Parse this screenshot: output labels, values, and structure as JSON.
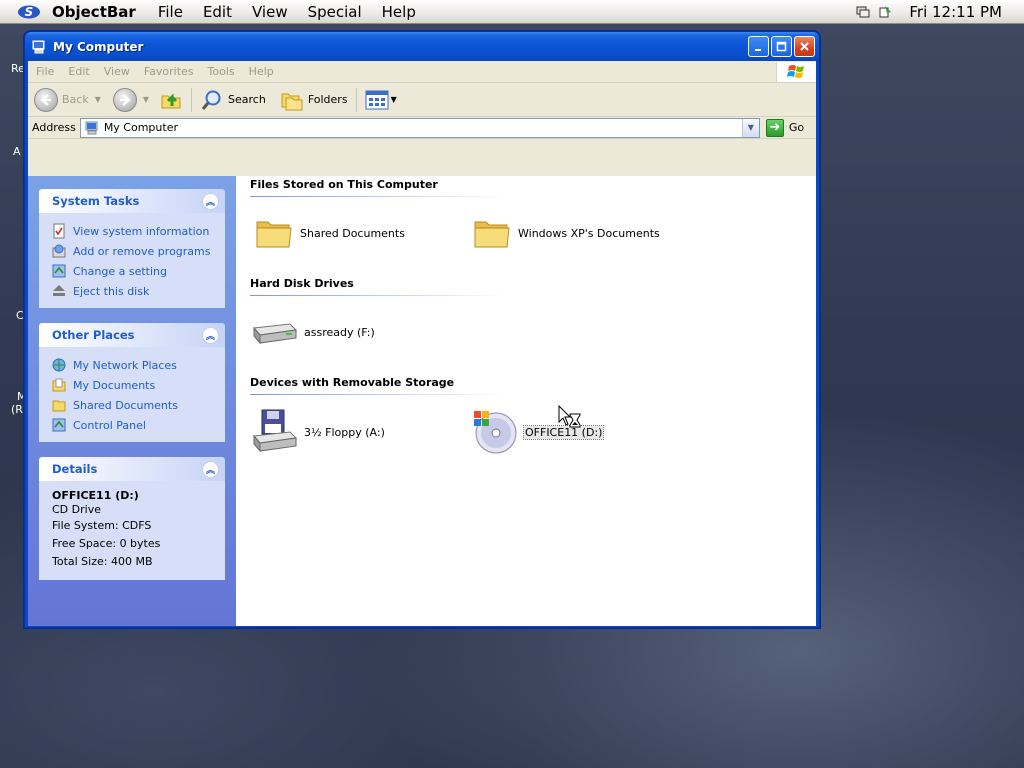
{
  "objectbar": {
    "app_name": "ObjectBar",
    "menus": [
      "File",
      "Edit",
      "View",
      "Special",
      "Help"
    ],
    "clock": "Fri 12:11 PM"
  },
  "desktop_fragments": [
    "Re",
    "A",
    "C",
    "M",
    "(R"
  ],
  "window": {
    "title": "My Computer",
    "menu": [
      "File",
      "Edit",
      "View",
      "Favorites",
      "Tools",
      "Help"
    ],
    "toolbar": {
      "back": "Back",
      "search": "Search",
      "folders": "Folders"
    },
    "address": {
      "label": "Address",
      "value": "My Computer",
      "go": "Go"
    }
  },
  "taskpane": {
    "system_tasks": {
      "title": "System Tasks",
      "items": [
        "View system information",
        "Add or remove programs",
        "Change a setting",
        "Eject this disk"
      ]
    },
    "other_places": {
      "title": "Other Places",
      "items": [
        "My Network Places",
        "My Documents",
        "Shared Documents",
        "Control Panel"
      ]
    },
    "details": {
      "title": "Details",
      "name": "OFFICE11 (D:)",
      "type": "CD Drive",
      "file_system": "File System: CDFS",
      "free_space": "Free Space: 0 bytes",
      "total_size": "Total Size: 400 MB"
    }
  },
  "content": {
    "groups": [
      {
        "title": "Files Stored on This Computer",
        "items": [
          "Shared Documents",
          "Windows XP's Documents"
        ]
      },
      {
        "title": "Hard Disk Drives",
        "items": [
          "assready (F:)"
        ]
      },
      {
        "title": "Devices with Removable Storage",
        "items": [
          "3½ Floppy (A:)",
          "OFFICE11 (D:)"
        ]
      }
    ]
  },
  "colors": {
    "title_blue": "#0a55d8",
    "taskpane_link": "#215dc6",
    "taskpane_bg": "#d6dff7"
  }
}
